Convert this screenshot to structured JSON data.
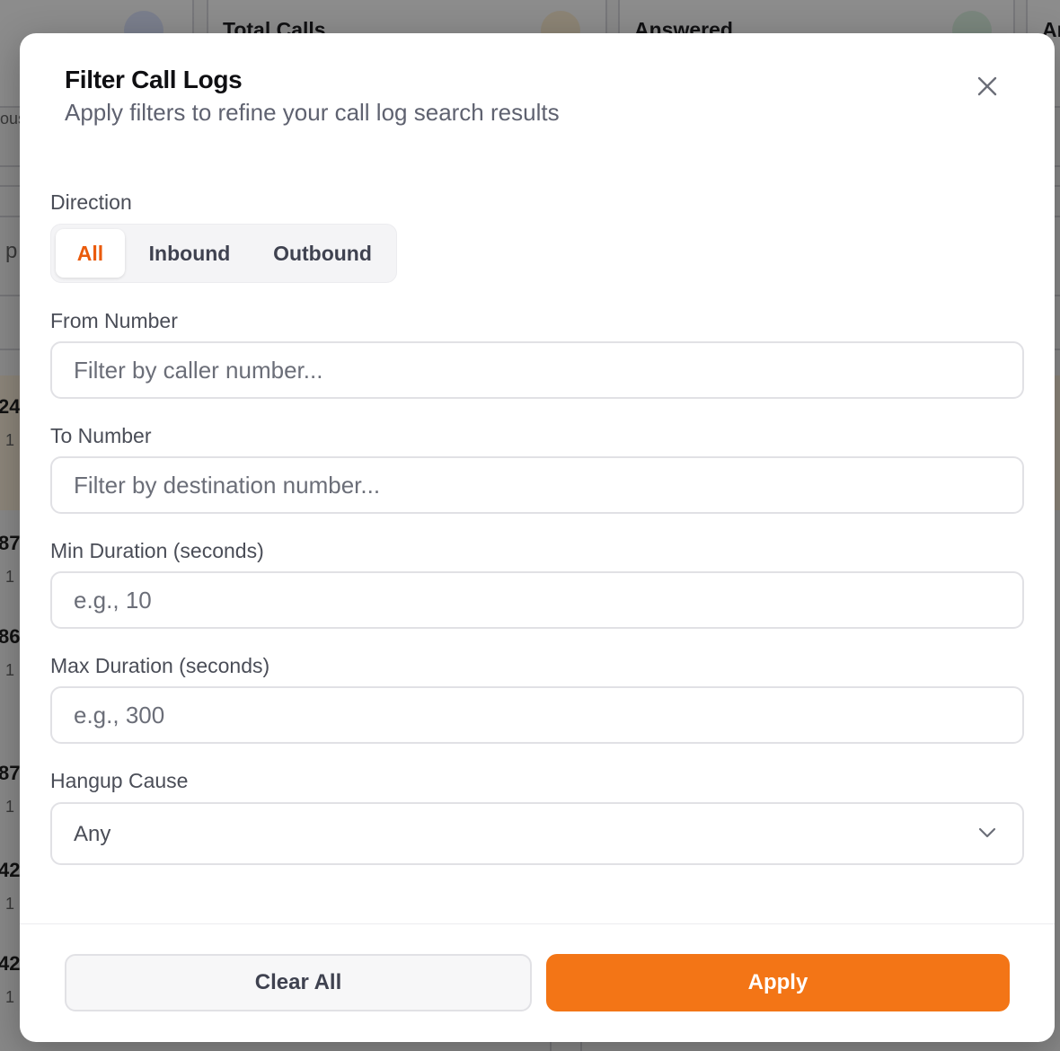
{
  "background": {
    "cards": [
      {
        "title": "Total Calls",
        "icon": "phone-icon",
        "icon_color": "#f2b84b"
      },
      {
        "title": "Answered",
        "icon": "check-circle-icon",
        "icon_color": "#3aa655"
      },
      {
        "title": "An",
        "icon": "",
        "icon_color": ""
      }
    ],
    "fragments": {
      "left_label": "ous",
      "left_letter": "p",
      "row_nums": [
        "24",
        "87",
        "86",
        "87",
        "42",
        "42"
      ],
      "row_sub": "1"
    }
  },
  "modal": {
    "title": "Filter Call Logs",
    "subtitle": "Apply filters to refine your call log search results",
    "close_icon": "close-icon",
    "direction": {
      "label": "Direction",
      "options": [
        "All",
        "Inbound",
        "Outbound"
      ],
      "selected": "All"
    },
    "from_number": {
      "label": "From Number",
      "placeholder": "Filter by caller number...",
      "value": ""
    },
    "to_number": {
      "label": "To Number",
      "placeholder": "Filter by destination number...",
      "value": ""
    },
    "min_duration": {
      "label": "Min Duration (seconds)",
      "placeholder": "e.g., 10",
      "value": ""
    },
    "max_duration": {
      "label": "Max Duration (seconds)",
      "placeholder": "e.g., 300",
      "value": ""
    },
    "hangup_cause": {
      "label": "Hangup Cause",
      "selected": "Any",
      "chevron_icon": "chevron-down-icon"
    },
    "actions": {
      "clear_label": "Clear All",
      "apply_label": "Apply"
    }
  },
  "colors": {
    "accent": "#f37516",
    "accent_text": "#ea5b0c",
    "overlay": "rgba(0,0,0,0.45)"
  }
}
